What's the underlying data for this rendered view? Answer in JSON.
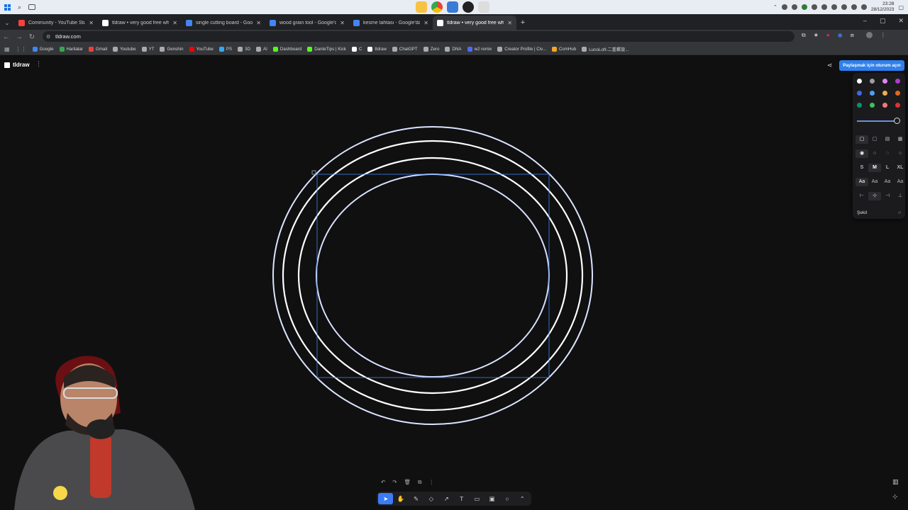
{
  "taskbar": {
    "time": "23:28",
    "date": "28/12/2023"
  },
  "tabs": [
    {
      "title": "Community - YouTube Studio",
      "color": "#ff3d3d",
      "active": false
    },
    {
      "title": "tldraw • very good free whiteb...",
      "color": "#ffffff",
      "active": false
    },
    {
      "title": "single cutting board - Google'...",
      "color": "#4285f4",
      "active": false
    },
    {
      "title": "wood grain tool - Google'da Ar...",
      "color": "#4285f4",
      "active": false
    },
    {
      "title": "kesme tahtası - Google'da Ara",
      "color": "#4285f4",
      "active": false
    },
    {
      "title": "tldraw • very good free whiteb...",
      "color": "#ffffff",
      "active": true
    }
  ],
  "address": {
    "url": "tldraw.com"
  },
  "bookmarks": [
    {
      "label": "Google",
      "color": "#4285f4"
    },
    {
      "label": "Haritalar",
      "color": "#34a853"
    },
    {
      "label": "Gmail",
      "color": "#ea4335"
    },
    {
      "label": "Youtube",
      "color": "#aaaaaa"
    },
    {
      "label": "YT",
      "color": "#aaaaaa"
    },
    {
      "label": "Genshin",
      "color": "#aaaaaa"
    },
    {
      "label": "YouTube",
      "color": "#ff0000"
    },
    {
      "label": "PS",
      "color": "#31a8ff"
    },
    {
      "label": "3D",
      "color": "#aaaaaa"
    },
    {
      "label": "AI",
      "color": "#aaaaaa"
    },
    {
      "label": "Dashboard",
      "color": "#53fc18"
    },
    {
      "label": "DanteTips | Kick",
      "color": "#53fc18"
    },
    {
      "label": "C",
      "color": "#ffffff"
    },
    {
      "label": "tldraw",
      "color": "#ffffff"
    },
    {
      "label": "ChatGPT",
      "color": "#aaaaaa"
    },
    {
      "label": "Zero",
      "color": "#aaaaaa"
    },
    {
      "label": "DNA",
      "color": "#aaaaaa"
    },
    {
      "label": "w2 remix",
      "color": "#4a6cf7"
    },
    {
      "label": "Creator Profile | Civ...",
      "color": "#aaaaaa"
    },
    {
      "label": "ComHub",
      "color": "#f5a623"
    },
    {
      "label": "LunoLoft-二重螺旋...",
      "color": "#aaaaaa"
    }
  ],
  "app": {
    "name": "tldraw",
    "share_label": "Paylaşmak için oturum açın"
  },
  "style_panel": {
    "colors": [
      "#ffffff",
      "#9e9e9e",
      "#e085f4",
      "#ae3ec9",
      "#4465e9",
      "#4ba1f1",
      "#f1ac4b",
      "#e16919",
      "#099268",
      "#40c057",
      "#f87777",
      "#e03131"
    ],
    "sizes": [
      "S",
      "M",
      "L",
      "XL"
    ],
    "fonts": [
      "Aa",
      "Aa",
      "Aa",
      "Aa"
    ],
    "shape_label": "Şekil"
  },
  "toolbar": {
    "tools": [
      "select",
      "hand",
      "draw",
      "eraser",
      "arrow",
      "text",
      "note",
      "media",
      "ellipse",
      "more"
    ]
  }
}
